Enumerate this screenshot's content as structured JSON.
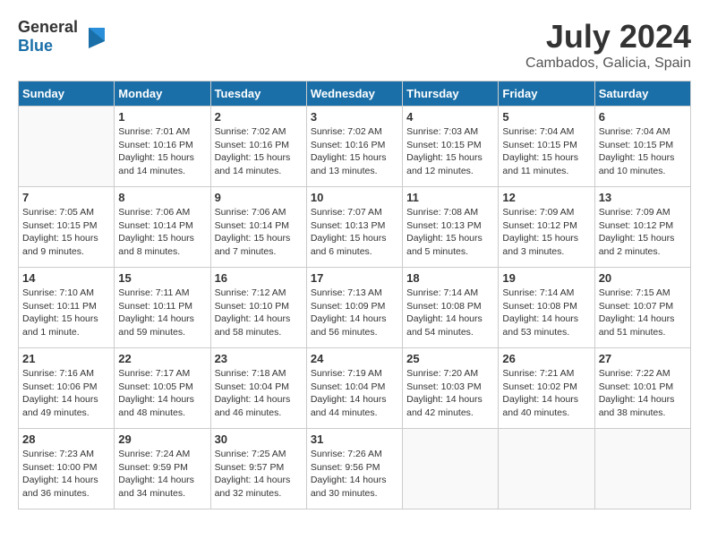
{
  "header": {
    "logo_general": "General",
    "logo_blue": "Blue",
    "month_year": "July 2024",
    "location": "Cambados, Galicia, Spain"
  },
  "days_of_week": [
    "Sunday",
    "Monday",
    "Tuesday",
    "Wednesday",
    "Thursday",
    "Friday",
    "Saturday"
  ],
  "weeks": [
    [
      {
        "day": "",
        "info": ""
      },
      {
        "day": "1",
        "info": "Sunrise: 7:01 AM\nSunset: 10:16 PM\nDaylight: 15 hours\nand 14 minutes."
      },
      {
        "day": "2",
        "info": "Sunrise: 7:02 AM\nSunset: 10:16 PM\nDaylight: 15 hours\nand 14 minutes."
      },
      {
        "day": "3",
        "info": "Sunrise: 7:02 AM\nSunset: 10:16 PM\nDaylight: 15 hours\nand 13 minutes."
      },
      {
        "day": "4",
        "info": "Sunrise: 7:03 AM\nSunset: 10:15 PM\nDaylight: 15 hours\nand 12 minutes."
      },
      {
        "day": "5",
        "info": "Sunrise: 7:04 AM\nSunset: 10:15 PM\nDaylight: 15 hours\nand 11 minutes."
      },
      {
        "day": "6",
        "info": "Sunrise: 7:04 AM\nSunset: 10:15 PM\nDaylight: 15 hours\nand 10 minutes."
      }
    ],
    [
      {
        "day": "7",
        "info": "Sunrise: 7:05 AM\nSunset: 10:15 PM\nDaylight: 15 hours\nand 9 minutes."
      },
      {
        "day": "8",
        "info": "Sunrise: 7:06 AM\nSunset: 10:14 PM\nDaylight: 15 hours\nand 8 minutes."
      },
      {
        "day": "9",
        "info": "Sunrise: 7:06 AM\nSunset: 10:14 PM\nDaylight: 15 hours\nand 7 minutes."
      },
      {
        "day": "10",
        "info": "Sunrise: 7:07 AM\nSunset: 10:13 PM\nDaylight: 15 hours\nand 6 minutes."
      },
      {
        "day": "11",
        "info": "Sunrise: 7:08 AM\nSunset: 10:13 PM\nDaylight: 15 hours\nand 5 minutes."
      },
      {
        "day": "12",
        "info": "Sunrise: 7:09 AM\nSunset: 10:12 PM\nDaylight: 15 hours\nand 3 minutes."
      },
      {
        "day": "13",
        "info": "Sunrise: 7:09 AM\nSunset: 10:12 PM\nDaylight: 15 hours\nand 2 minutes."
      }
    ],
    [
      {
        "day": "14",
        "info": "Sunrise: 7:10 AM\nSunset: 10:11 PM\nDaylight: 15 hours\nand 1 minute."
      },
      {
        "day": "15",
        "info": "Sunrise: 7:11 AM\nSunset: 10:11 PM\nDaylight: 14 hours\nand 59 minutes."
      },
      {
        "day": "16",
        "info": "Sunrise: 7:12 AM\nSunset: 10:10 PM\nDaylight: 14 hours\nand 58 minutes."
      },
      {
        "day": "17",
        "info": "Sunrise: 7:13 AM\nSunset: 10:09 PM\nDaylight: 14 hours\nand 56 minutes."
      },
      {
        "day": "18",
        "info": "Sunrise: 7:14 AM\nSunset: 10:08 PM\nDaylight: 14 hours\nand 54 minutes."
      },
      {
        "day": "19",
        "info": "Sunrise: 7:14 AM\nSunset: 10:08 PM\nDaylight: 14 hours\nand 53 minutes."
      },
      {
        "day": "20",
        "info": "Sunrise: 7:15 AM\nSunset: 10:07 PM\nDaylight: 14 hours\nand 51 minutes."
      }
    ],
    [
      {
        "day": "21",
        "info": "Sunrise: 7:16 AM\nSunset: 10:06 PM\nDaylight: 14 hours\nand 49 minutes."
      },
      {
        "day": "22",
        "info": "Sunrise: 7:17 AM\nSunset: 10:05 PM\nDaylight: 14 hours\nand 48 minutes."
      },
      {
        "day": "23",
        "info": "Sunrise: 7:18 AM\nSunset: 10:04 PM\nDaylight: 14 hours\nand 46 minutes."
      },
      {
        "day": "24",
        "info": "Sunrise: 7:19 AM\nSunset: 10:04 PM\nDaylight: 14 hours\nand 44 minutes."
      },
      {
        "day": "25",
        "info": "Sunrise: 7:20 AM\nSunset: 10:03 PM\nDaylight: 14 hours\nand 42 minutes."
      },
      {
        "day": "26",
        "info": "Sunrise: 7:21 AM\nSunset: 10:02 PM\nDaylight: 14 hours\nand 40 minutes."
      },
      {
        "day": "27",
        "info": "Sunrise: 7:22 AM\nSunset: 10:01 PM\nDaylight: 14 hours\nand 38 minutes."
      }
    ],
    [
      {
        "day": "28",
        "info": "Sunrise: 7:23 AM\nSunset: 10:00 PM\nDaylight: 14 hours\nand 36 minutes."
      },
      {
        "day": "29",
        "info": "Sunrise: 7:24 AM\nSunset: 9:59 PM\nDaylight: 14 hours\nand 34 minutes."
      },
      {
        "day": "30",
        "info": "Sunrise: 7:25 AM\nSunset: 9:57 PM\nDaylight: 14 hours\nand 32 minutes."
      },
      {
        "day": "31",
        "info": "Sunrise: 7:26 AM\nSunset: 9:56 PM\nDaylight: 14 hours\nand 30 minutes."
      },
      {
        "day": "",
        "info": ""
      },
      {
        "day": "",
        "info": ""
      },
      {
        "day": "",
        "info": ""
      }
    ]
  ]
}
